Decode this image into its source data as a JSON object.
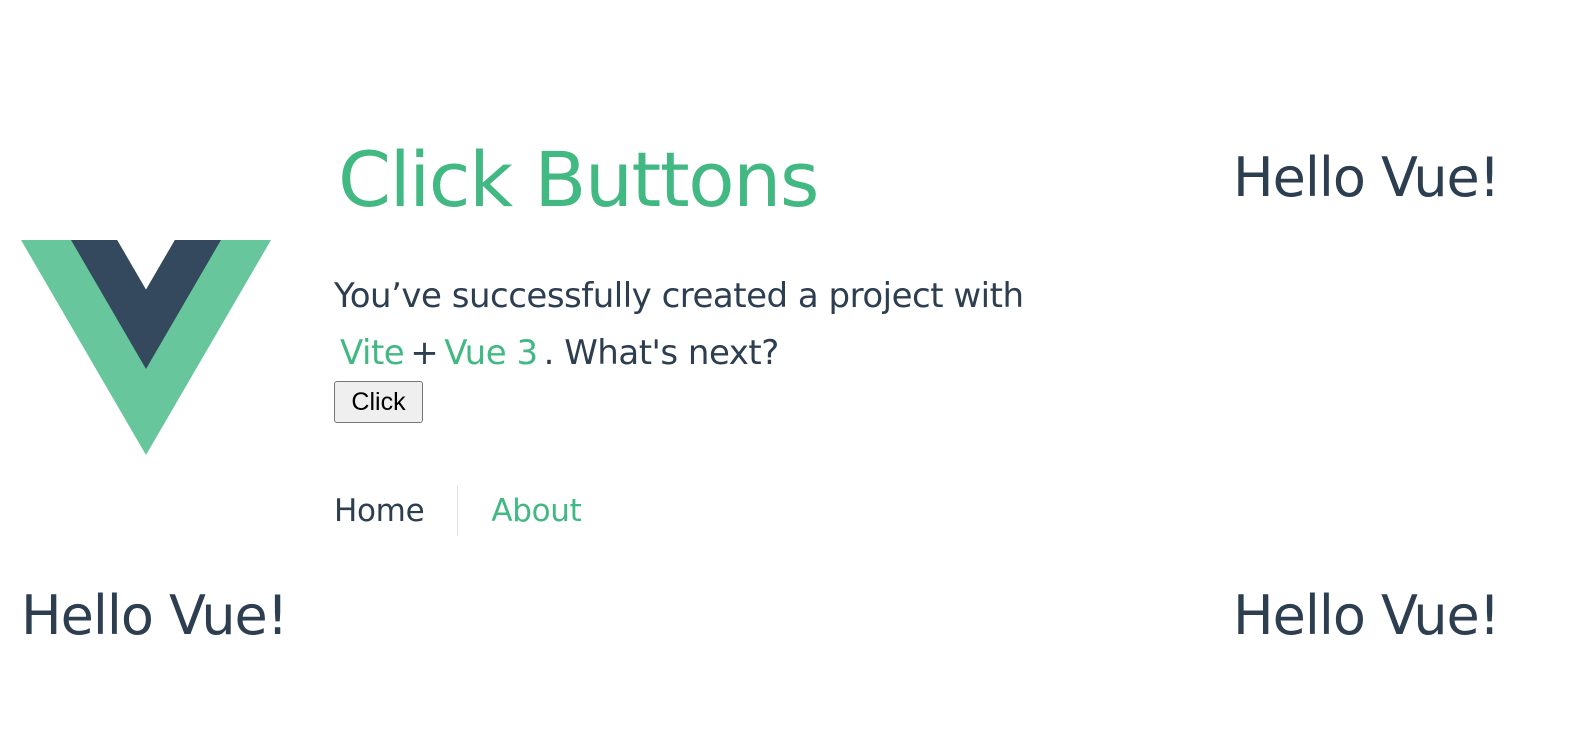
{
  "header": {
    "title": "Click Buttons",
    "greeting": "Hello Vue!"
  },
  "intro": {
    "text_before": "You’ve successfully created a project with",
    "link_vite": "Vite",
    "plus": "+",
    "link_vue": "Vue 3",
    "text_after": ". What's next?"
  },
  "button": {
    "label": "Click"
  },
  "nav": {
    "items": [
      {
        "label": "Home"
      },
      {
        "label": "About"
      }
    ]
  },
  "footer": {
    "greeting_left": "Hello Vue!",
    "greeting_right": "Hello Vue!"
  },
  "colors": {
    "brand_green": "#42b883",
    "logo_green": "#41b883",
    "logo_dark": "#34495e",
    "text_dark": "#2c3e50"
  },
  "icons": {
    "logo": "vue-logo-icon"
  }
}
